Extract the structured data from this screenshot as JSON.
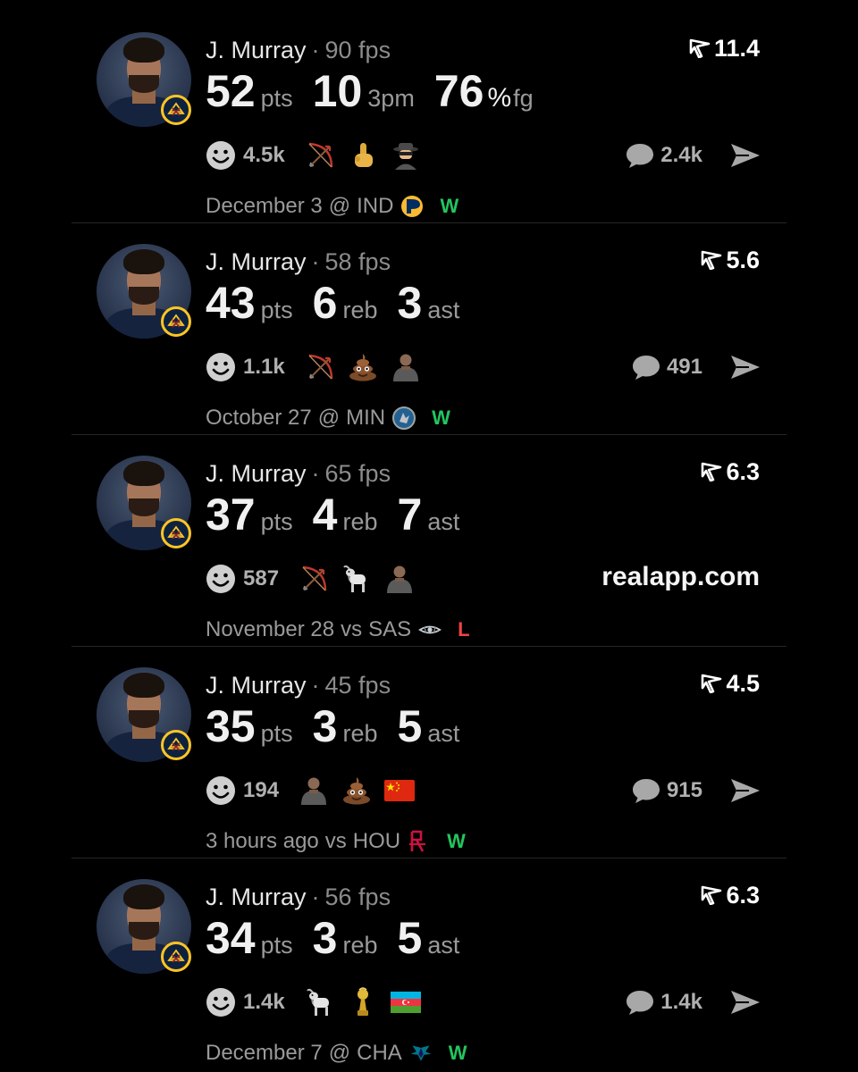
{
  "colors": {
    "background": "#000000",
    "win": "#22c55e",
    "loss": "#ef4444",
    "muted": "#9a9a9a",
    "team_badge_gold": "#fec524",
    "team_badge_navy": "#0e2240"
  },
  "posts": [
    {
      "player": "J. Murray",
      "fps": "90 fps",
      "rating": "11.4",
      "stats": [
        {
          "value": "52",
          "unit": "pts"
        },
        {
          "value": "10",
          "unit": "3pm"
        },
        {
          "value": "76",
          "suffix": "%",
          "unit": "fg"
        }
      ],
      "reaction_count": "4.5k",
      "emojis": [
        "bow-and-arrow-icon",
        "middle-finger-icon",
        "spy-icon"
      ],
      "comment_count": "2.4k",
      "date": "December 3",
      "venue": "@",
      "opponent": "IND",
      "opponent_logo": "pacers-logo-icon",
      "result": "W"
    },
    {
      "player": "J. Murray",
      "fps": "58 fps",
      "rating": "5.6",
      "stats": [
        {
          "value": "43",
          "unit": "pts"
        },
        {
          "value": "6",
          "unit": "reb"
        },
        {
          "value": "3",
          "unit": "ast"
        }
      ],
      "reaction_count": "1.1k",
      "emojis": [
        "bow-and-arrow-icon",
        "poop-icon",
        "player-sticker-icon"
      ],
      "comment_count": "491",
      "date": "October 27",
      "venue": "@",
      "opponent": "MIN",
      "opponent_logo": "timberwolves-logo-icon",
      "result": "W"
    },
    {
      "player": "J. Murray",
      "fps": "65 fps",
      "rating": "6.3",
      "stats": [
        {
          "value": "37",
          "unit": "pts"
        },
        {
          "value": "4",
          "unit": "reb"
        },
        {
          "value": "7",
          "unit": "ast"
        }
      ],
      "reaction_count": "587",
      "emojis": [
        "bow-and-arrow-icon",
        "goat-icon",
        "player-sticker-icon"
      ],
      "site": "realapp.com",
      "date": "November 28",
      "venue": "vs",
      "opponent": "SAS",
      "opponent_logo": "spurs-logo-icon",
      "result": "L"
    },
    {
      "player": "J. Murray",
      "fps": "45 fps",
      "rating": "4.5",
      "stats": [
        {
          "value": "35",
          "unit": "pts"
        },
        {
          "value": "3",
          "unit": "reb"
        },
        {
          "value": "5",
          "unit": "ast"
        }
      ],
      "reaction_count": "194",
      "emojis": [
        "player-sticker-icon",
        "poop-icon",
        "china-flag-icon"
      ],
      "comment_count": "915",
      "date": "3 hours ago",
      "venue": "vs",
      "opponent": "HOU",
      "opponent_logo": "rockets-logo-icon",
      "result": "W"
    },
    {
      "player": "J. Murray",
      "fps": "56 fps",
      "rating": "6.3",
      "stats": [
        {
          "value": "34",
          "unit": "pts"
        },
        {
          "value": "3",
          "unit": "reb"
        },
        {
          "value": "5",
          "unit": "ast"
        }
      ],
      "reaction_count": "1.4k",
      "emojis": [
        "goat-icon",
        "trophy-icon",
        "azerbaijan-flag-icon"
      ],
      "comment_count": "1.4k",
      "date": "December 7",
      "venue": "@",
      "opponent": "CHA",
      "opponent_logo": "hornets-logo-icon",
      "result": "W"
    }
  ]
}
